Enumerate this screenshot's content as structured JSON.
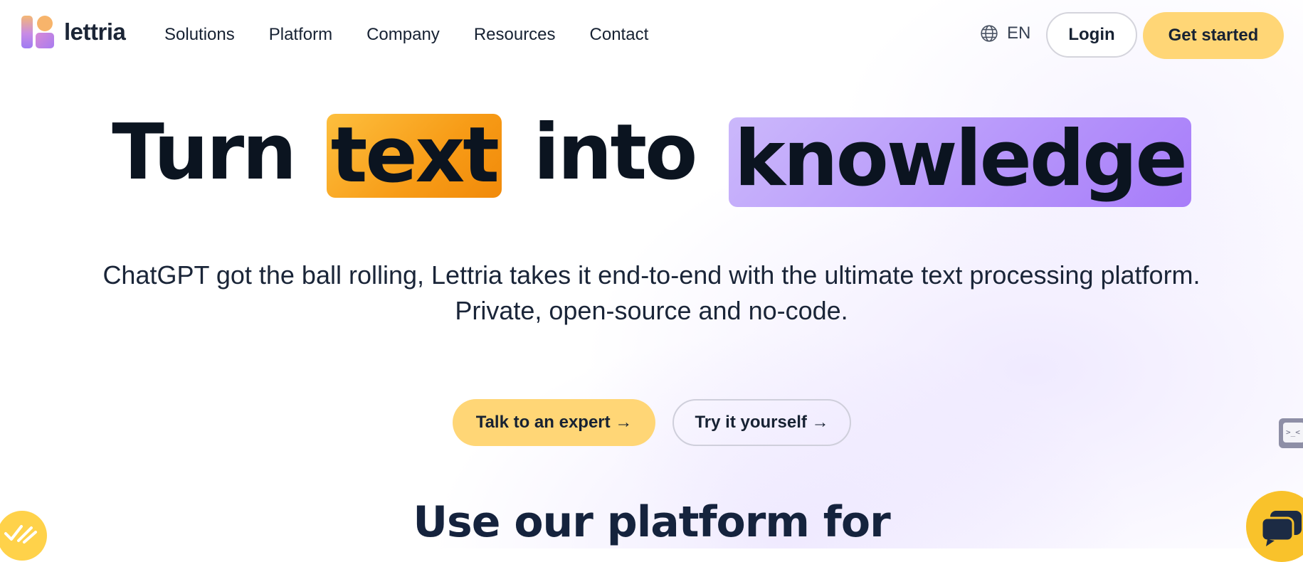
{
  "brand": {
    "name": "lettria"
  },
  "nav": {
    "items": [
      {
        "label": "Solutions"
      },
      {
        "label": "Platform"
      },
      {
        "label": "Company"
      },
      {
        "label": "Resources"
      },
      {
        "label": "Contact"
      }
    ]
  },
  "header": {
    "language": "EN",
    "login_label": "Login",
    "get_started_label": "Get started"
  },
  "hero": {
    "headline": {
      "word1": "Turn",
      "word2": "text",
      "word3": "into",
      "word4": "knowledge"
    },
    "subtitle": "ChatGPT got the ball rolling, Lettria takes it end-to-end with the ultimate text processing platform. Private, open-source and no-code.",
    "cta_primary": "Talk to an expert →",
    "cta_secondary": "Try it yourself →"
  },
  "section": {
    "title": "Use our platform for"
  },
  "widgets": {
    "side_tab_text": ">_<"
  },
  "colors": {
    "accent_yellow": "#ffd676",
    "highlight_orange": "#f79b16",
    "highlight_purple": "#b797fb",
    "text_dark": "#0b1420"
  },
  "icons": {
    "language": "globe-icon",
    "left_widget": "checklist-icon",
    "chat": "chat-icon"
  }
}
